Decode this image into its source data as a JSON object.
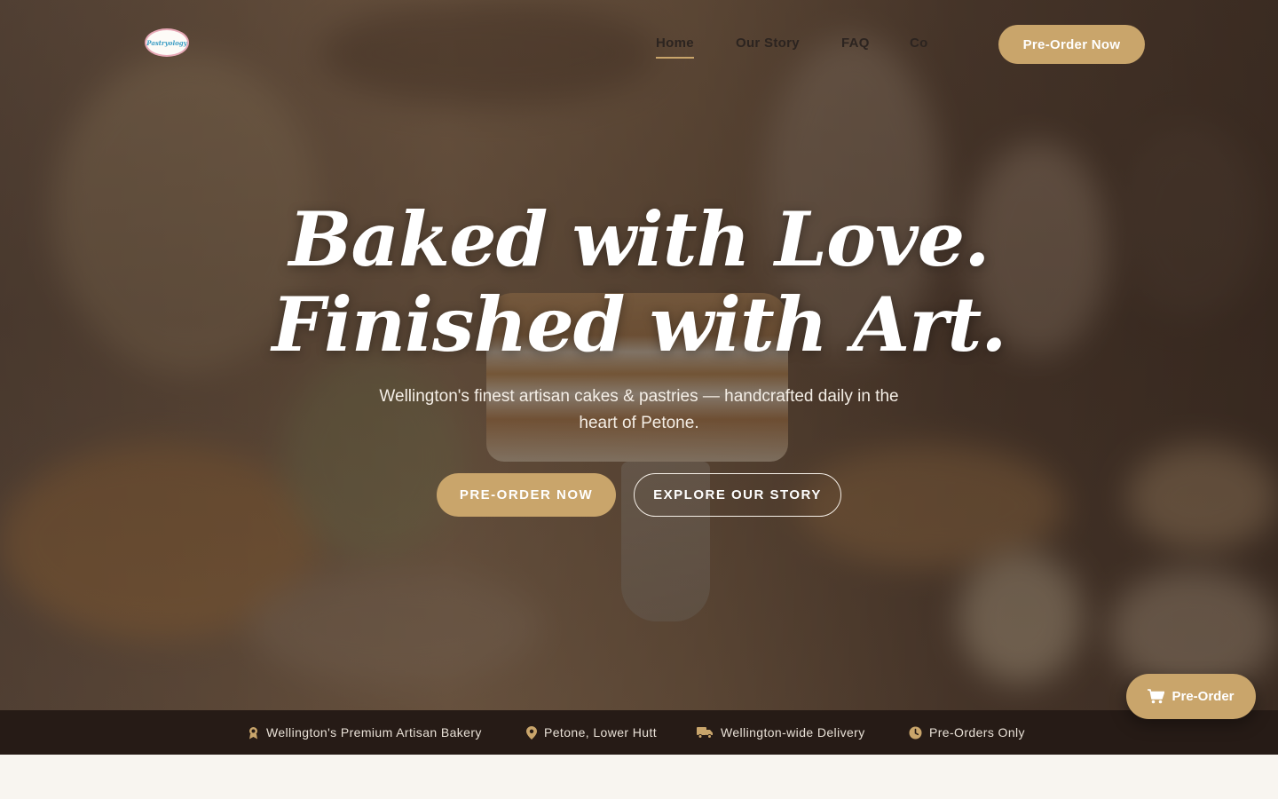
{
  "nav": {
    "logo_text": "Pastryology",
    "links": [
      {
        "label": "Home",
        "active": true
      },
      {
        "label": "Our Story",
        "active": false
      },
      {
        "label": "FAQ",
        "active": false
      },
      {
        "label": "Co",
        "active": false
      }
    ],
    "cta_label": "Pre-Order Now"
  },
  "hero": {
    "headline_line1": "Baked with Love.",
    "headline_line2": "Finished with Art.",
    "subhead": "Wellington's finest artisan cakes & pastries — handcrafted daily in the heart of Petone.",
    "primary_button": "PRE-ORDER NOW",
    "secondary_button": "EXPLORE OUR STORY"
  },
  "info_bar": {
    "items": [
      {
        "icon": "award-icon",
        "label": "Wellington's Premium Artisan Bakery"
      },
      {
        "icon": "location-pin-icon",
        "label": "Petone, Lower Hutt"
      },
      {
        "icon": "delivery-truck-icon",
        "label": "Wellington-wide Delivery"
      },
      {
        "icon": "clock-icon",
        "label": "Pre-Orders Only"
      }
    ]
  },
  "floating_button": {
    "icon": "cart-icon",
    "label": "Pre-Order"
  },
  "colors": {
    "accent": "#c9a56b",
    "info_bar_bg": "#261b16",
    "nav_text": "#2c2420"
  }
}
